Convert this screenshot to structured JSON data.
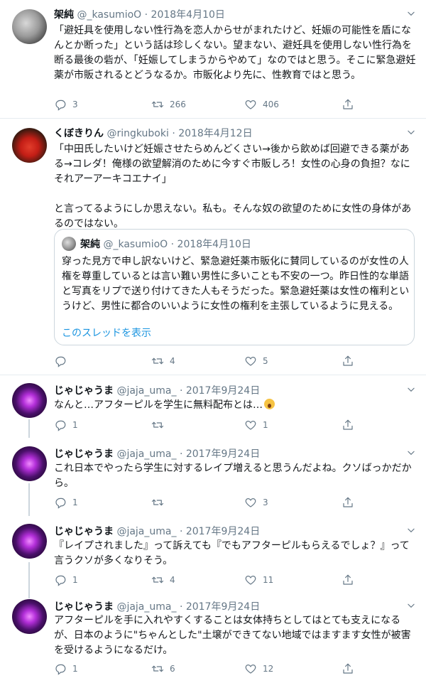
{
  "tweets": [
    {
      "name": "架純",
      "handle": "@_kasumioO",
      "date": "· 2018年4月10日",
      "text": "「避妊具を使用しない性行為を恋人からせがまれたけど、妊娠の可能性を盾になんとか断った」という話は珍しくない。望まない、避妊具を使用しない性行為を断る最後の砦が、「妊娠してしまうからやめて」なのではと思う。そこに緊急避妊薬が市販されるとどうなるか。市販化より先に、性教育ではと思う。",
      "replies": "3",
      "retweets": "266",
      "likes": "406"
    },
    {
      "name": "くぼきりん",
      "handle": "@ringkuboki",
      "date": "· 2018年4月12日",
      "text": "「中田氏したいけど妊娠させたらめんどくさい→後から飲めば回避できる薬がある→コレダ！俺様の欲望解消のために今すぐ市販しろ！女性の心身の負担？なにそれアーアーキコエナイ」\n\nと言ってるようにしか思えない。私も。そんな奴の欲望のために女性の身体があるのではない。",
      "quote": {
        "name": "架純",
        "handle": "@_kasumioO",
        "date": "· 2018年4月10日",
        "text": "穿った見方で申し訳ないけど、緊急避妊薬市販化に賛同しているのが女性の人権を尊重しているとは言い難い男性に多いことも不安の一つ。昨日性的な単語と写真をリプで送り付けてきた人もそうだった。緊急避妊薬は女性の権利というけど、男性に都合のいいように女性の権利を主張しているように見える。",
        "show_thread": "このスレッドを表示"
      },
      "replies": "",
      "retweets": "4",
      "likes": "5"
    },
    {
      "name": "じゃじゃうま",
      "handle": "@jaja_uma_",
      "date": "· 2017年9月24日",
      "text": "なんと…アフターピルを学生に無料配布とは…",
      "replies": "1",
      "retweets": "",
      "likes": "1"
    },
    {
      "name": "じゃじゃうま",
      "handle": "@jaja_uma_",
      "date": "· 2017年9月24日",
      "text": "これ日本でやったら学生に対するレイプ増えると思うんだよね。クソばっかだから。",
      "replies": "1",
      "retweets": "",
      "likes": "3"
    },
    {
      "name": "じゃじゃうま",
      "handle": "@jaja_uma_",
      "date": "· 2017年9月24日",
      "text": "『レイプされました』って訴えても『でもアフターピルもらえるでしょ？』って言うクソが多くなりそう。",
      "replies": "1",
      "retweets": "4",
      "likes": "11"
    },
    {
      "name": "じゃじゃうま",
      "handle": "@jaja_uma_",
      "date": "· 2017年9月24日",
      "text": "アフターピルを手に入れやすくすることは女体持ちとしてはとても支えになるが、日本のように\"ちゃんとした\"土壌ができてない地域ではますます女性が被害を受けるようになるだけ。",
      "replies": "1",
      "retweets": "6",
      "likes": "12"
    }
  ],
  "icons": [
    "reply-icon",
    "retweet-icon",
    "like-icon",
    "share-icon",
    "chevron-down-icon",
    "astonished-face-emoji"
  ]
}
